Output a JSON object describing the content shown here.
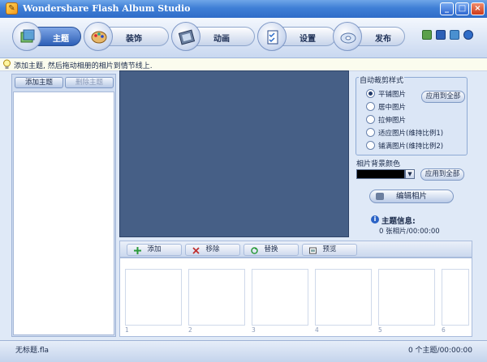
{
  "window": {
    "title": "Wondershare Flash Album Studio",
    "minimize": "_",
    "maximize": "□",
    "close": "×"
  },
  "nav": {
    "tabs": [
      {
        "label": "主题"
      },
      {
        "label": "装饰"
      },
      {
        "label": "动画"
      },
      {
        "label": "设置"
      },
      {
        "label": "发布"
      }
    ]
  },
  "hint": "添加主题, 然后拖动相册的相片到情节线上.",
  "left": {
    "add_theme": "添加主题",
    "delete_theme": "删除主题"
  },
  "crop": {
    "title": "自动裁剪样式",
    "options": [
      "平铺图片",
      "居中图片",
      "拉伸图片",
      "适应图片(维持比例1)",
      "铺满图片(维持比例2)"
    ],
    "selected": 0,
    "apply_all": "应用到全部"
  },
  "background": {
    "label": "相片背景颜色",
    "color": "#000000",
    "apply_all": "应用到全部"
  },
  "edit_photo": "编辑相片",
  "info": {
    "title": "主题信息:",
    "value": "0 张相片/00:00:00"
  },
  "toolbar": {
    "add": "添加",
    "remove": "移除",
    "replace": "替换",
    "preview": "预览"
  },
  "slots": [
    "1",
    "2",
    "3",
    "4",
    "5",
    "6"
  ],
  "status": {
    "left": "无标题.fla",
    "right": "0 个主题/00:00:00"
  }
}
